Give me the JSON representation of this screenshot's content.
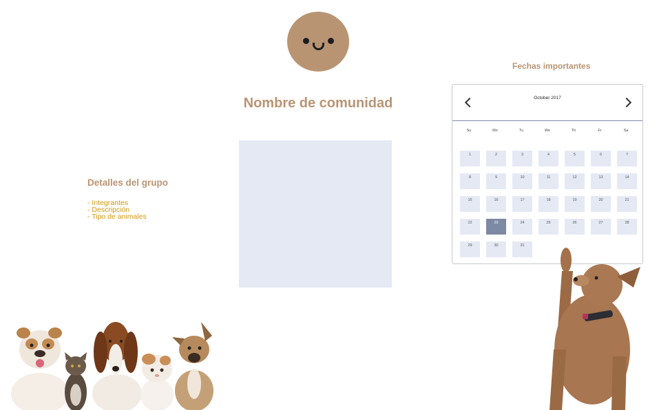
{
  "community": {
    "name": "Nombre de comunidad"
  },
  "details": {
    "title": "Detalles del grupo",
    "items": [
      "- Integrantes",
      "- Descripción",
      "- Tipo de animales"
    ]
  },
  "dates": {
    "title": "Fechas importantes"
  },
  "calendar": {
    "month_label": "October 2017",
    "weekdays": [
      "Su",
      "Mo",
      "Tu",
      "We",
      "Th",
      "Fr",
      "Sa"
    ],
    "days": [
      "1",
      "2",
      "3",
      "4",
      "5",
      "6",
      "7",
      "8",
      "9",
      "10",
      "11",
      "12",
      "13",
      "14",
      "15",
      "16",
      "17",
      "18",
      "19",
      "20",
      "21",
      "22",
      "23",
      "24",
      "25",
      "26",
      "27",
      "28",
      "29",
      "30",
      "31"
    ],
    "selected_day": "23"
  },
  "colors": {
    "accent": "#b99473",
    "list_text": "#d4980c",
    "day_bg": "#e4e9f4",
    "selected_bg": "#7d8aa3"
  },
  "icons": {
    "prev": "chevron-left-icon",
    "next": "chevron-right-icon"
  }
}
